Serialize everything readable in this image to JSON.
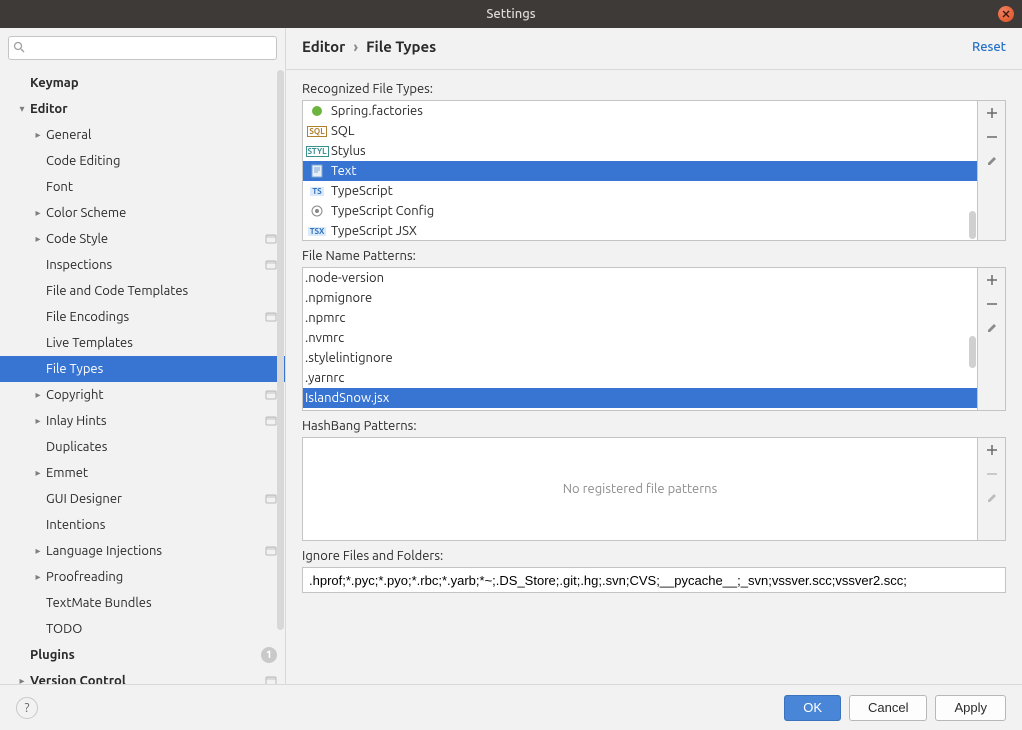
{
  "titlebar": {
    "title": "Settings"
  },
  "search": {
    "placeholder": ""
  },
  "nav": {
    "keymap": "Keymap",
    "editor": "Editor",
    "general": "General",
    "code_editing": "Code Editing",
    "font": "Font",
    "color_scheme": "Color Scheme",
    "code_style": "Code Style",
    "inspections": "Inspections",
    "file_code_templates": "File and Code Templates",
    "file_encodings": "File Encodings",
    "live_templates": "Live Templates",
    "file_types": "File Types",
    "copyright": "Copyright",
    "inlay_hints": "Inlay Hints",
    "duplicates": "Duplicates",
    "emmet": "Emmet",
    "gui_designer": "GUI Designer",
    "intentions": "Intentions",
    "language_injections": "Language Injections",
    "proofreading": "Proofreading",
    "textmate_bundles": "TextMate Bundles",
    "todo": "TODO",
    "plugins": "Plugins",
    "plugins_badge": "1",
    "version_control": "Version Control"
  },
  "breadcrumb": {
    "parent": "Editor",
    "current": "File Types",
    "reset": "Reset"
  },
  "sections": {
    "recognized": "Recognized File Types:",
    "patterns": "File Name Patterns:",
    "hashbang": "HashBang Patterns:",
    "ignore": "Ignore Files and Folders:"
  },
  "recognized_types": [
    {
      "label": "Spring.factories",
      "icon": "spring"
    },
    {
      "label": "SQL",
      "icon": "sql"
    },
    {
      "label": "Stylus",
      "icon": "styl"
    },
    {
      "label": "Text",
      "icon": "text",
      "selected": true
    },
    {
      "label": "TypeScript",
      "icon": "ts"
    },
    {
      "label": "TypeScript Config",
      "icon": "tsconfig"
    },
    {
      "label": "TypeScript JSX",
      "icon": "tsx"
    }
  ],
  "patterns": [
    ".node-version",
    ".npmignore",
    ".npmrc",
    ".nvmrc",
    ".stylelintignore",
    ".yarnrc",
    "IslandSnow.jsx"
  ],
  "patterns_selected_index": 6,
  "hashbang_empty": "No registered file patterns",
  "ignore_value": ".hprof;*.pyc;*.pyo;*.rbc;*.yarb;*~;.DS_Store;.git;.hg;.svn;CVS;__pycache__;_svn;vssver.scc;vssver2.scc;",
  "buttons": {
    "ok": "OK",
    "cancel": "Cancel",
    "apply": "Apply"
  }
}
